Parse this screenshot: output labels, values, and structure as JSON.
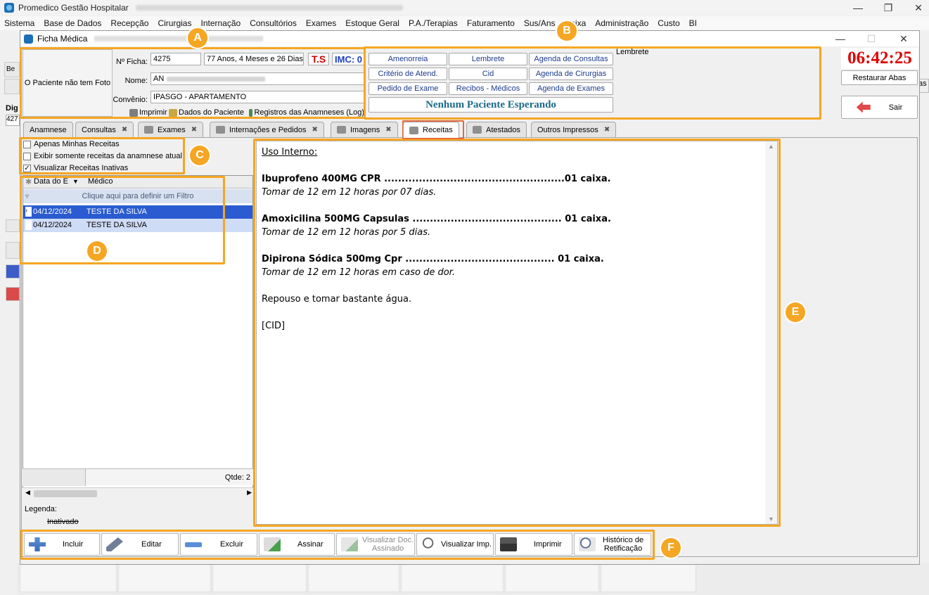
{
  "app": {
    "title": "Promedico Gestão Hospitalar",
    "menu": [
      "Sistema",
      "Base de Dados",
      "Recepção",
      "Cirurgias",
      "Internação",
      "Consultórios",
      "Exames",
      "Estoque Geral",
      "P.A./Terapias",
      "Faturamento",
      "Sus/Ans",
      "Caixa",
      "Administração",
      "Custo",
      "BI"
    ]
  },
  "window": {
    "title": "Ficha Médica"
  },
  "callouts": {
    "a": "A",
    "b": "B",
    "c": "C",
    "d": "D",
    "e": "E",
    "f": "F"
  },
  "patient": {
    "photo_text": "O Paciente não tem Foto",
    "ficha_label": "Nº Ficha:",
    "ficha_value": "4275",
    "age": "77 Anos, 4 Meses e 26 Dias",
    "ts": "T.S",
    "imc": "IMC: 0",
    "name_label": "Nome:",
    "name_value": "AN",
    "convenio_label": "Convênio:",
    "convenio_value": "IPASGO - APARTAMENTO",
    "print_label": "Imprimir",
    "dados_label": "Dados do Paciente",
    "registros_label": "Registros das Anamneses (Log)"
  },
  "shortcuts": [
    [
      "Amenorreia",
      "Lembrete",
      "Agenda de Consultas"
    ],
    [
      "Critério de Atend.",
      "Cid",
      "Agenda de Cirurgias"
    ],
    [
      "Pedido de Exame",
      "Recibos - Médicos",
      "Agenda de Exames"
    ]
  ],
  "waiting": "Nenhum Paciente Esperando",
  "lembrete_label": "Lembrete",
  "clock": "06:42:25",
  "restaurar": "Restaurar Abas",
  "sair": "Sair",
  "tabs": [
    {
      "label": "Anamnese",
      "close": false
    },
    {
      "label": "Consultas",
      "close": true
    },
    {
      "label": "Exames",
      "close": true
    },
    {
      "label": "Internações e Pedidos",
      "close": true
    },
    {
      "label": "Imagens",
      "close": true
    },
    {
      "label": "Receitas",
      "close": false
    },
    {
      "label": "Atestados",
      "close": false
    },
    {
      "label": "Outros Impressos",
      "close": true
    }
  ],
  "filters": [
    {
      "label": "Apenas Minhas Receitas",
      "checked": false
    },
    {
      "label": "Exibir somente receitas da anamnese atual",
      "checked": false
    },
    {
      "label": "Visualizar Receitas Inativas",
      "checked": true
    }
  ],
  "grid": {
    "col_date": "Data do E",
    "col_medico": "Médico",
    "filter_hint": "Clique aqui para definir um Filtro",
    "rows": [
      {
        "date": "04/12/2024",
        "medico": "TESTE DA SILVA"
      },
      {
        "date": "04/12/2024",
        "medico": "TESTE DA SILVA"
      }
    ],
    "qtde": "Qtde: 2"
  },
  "legend": {
    "title": "Legenda:",
    "inativado": "Inativado"
  },
  "prescription": {
    "header": "Uso Interno:",
    "items": [
      {
        "line": "Ibuprofeno 400MG CPR ....................................................01 caixa.",
        "instr": "Tomar de 12 em 12 horas por 07 dias."
      },
      {
        "line": "Amoxicilina 500MG Capsulas ........................................... 01 caixa.",
        "instr": "Tomar de 12 em 12 horas por 5 dias."
      },
      {
        "line": "Dipirona Sódica 500mg Cpr ........................................... 01 caixa.",
        "instr": "Tomar de 12 em 12 horas em caso de dor."
      }
    ],
    "note": "Repouso e tomar bastante água.",
    "cid": "[CID]"
  },
  "toolbar": {
    "incluir": "Incluir",
    "editar": "Editar",
    "excluir": "Excluir",
    "assinar": "Assinar",
    "visualizar_doc_1": "Visualizar Doc.",
    "visualizar_doc_2": "Assinado",
    "visualizar_imp": "Visualizar Imp.",
    "imprimir": "Imprimir",
    "historico_1": "Histórico de",
    "historico_2": "Retificação"
  },
  "colors": {
    "accent": "#f5a623",
    "clock": "#dd0000",
    "selection": "#2a5bd0"
  }
}
